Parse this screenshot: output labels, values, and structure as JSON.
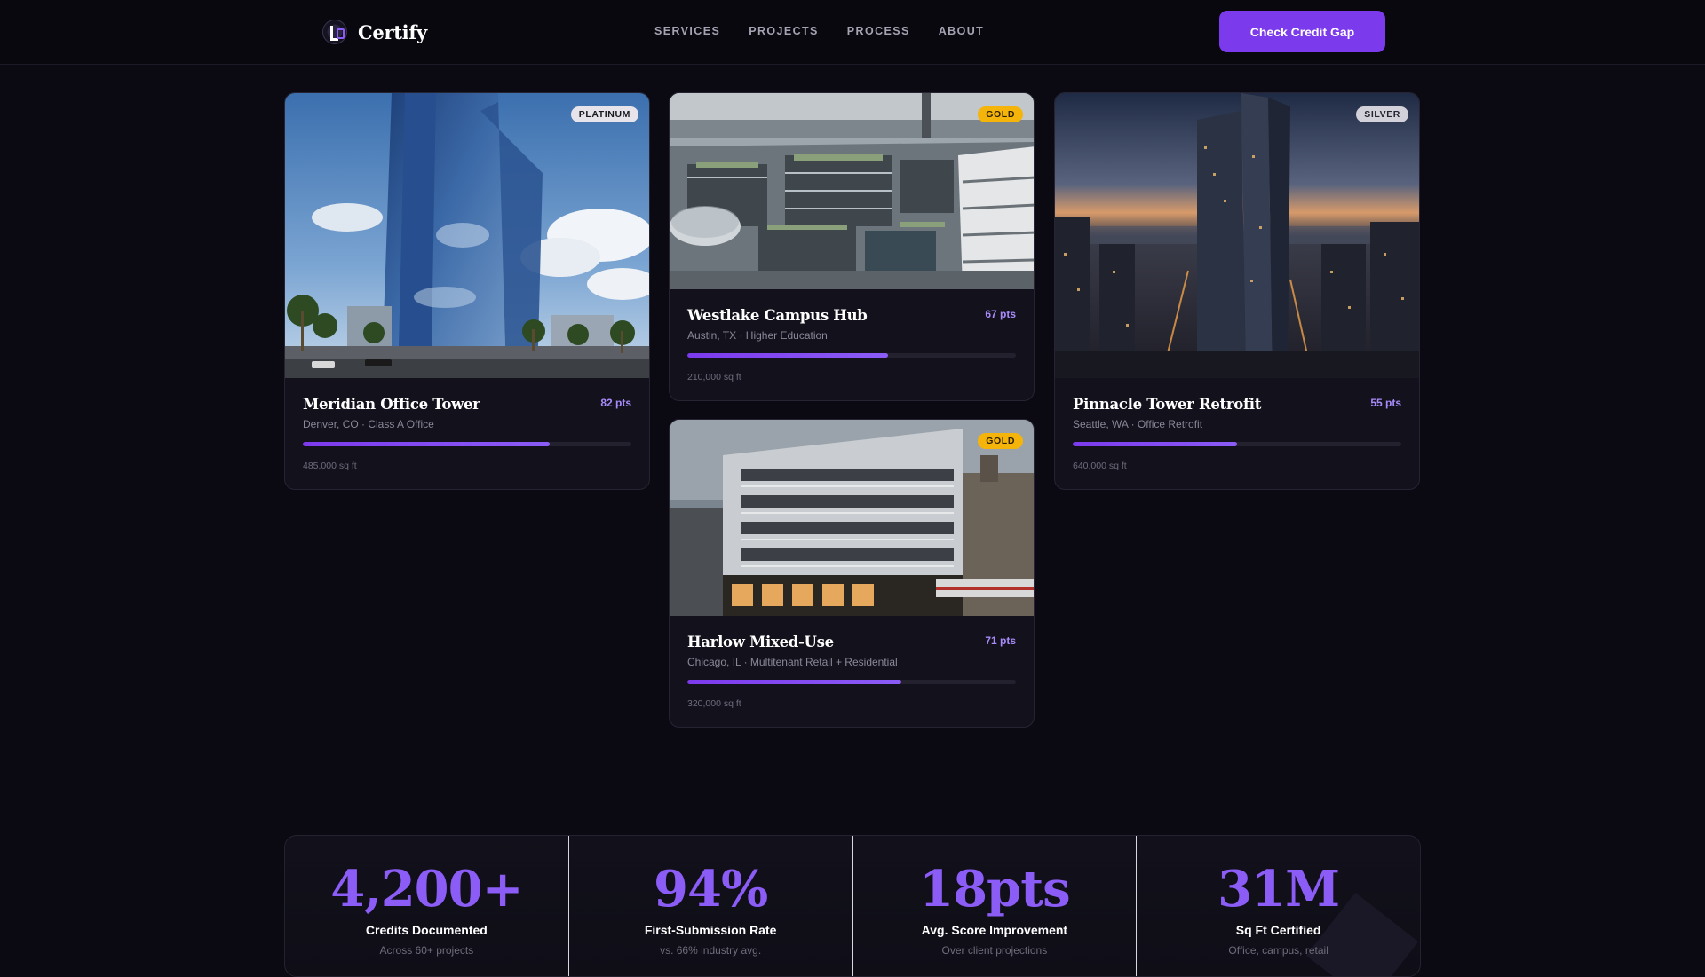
{
  "brand": {
    "name": "Certify"
  },
  "nav": {
    "links": [
      "SERVICES",
      "PROJECTS",
      "PROCESS",
      "ABOUT"
    ],
    "cta_label": "Check Credit Gap"
  },
  "colors": {
    "accent": "#7c3aed",
    "accent_light": "#8b5cf6",
    "background": "#0b0a12",
    "gold": "#f5b40a"
  },
  "projects": [
    {
      "title": "Meridian Office Tower",
      "location": "Denver, CO · Class A Office",
      "points": "82 pts",
      "badge": "PLATINUM",
      "sqft": "485,000 sq ft",
      "progress": 0.75
    },
    {
      "title": "Westlake Campus Hub",
      "location": "Austin, TX · Higher Education",
      "points": "67 pts",
      "badge": "GOLD",
      "sqft": "210,000 sq ft",
      "progress": 0.61
    },
    {
      "title": "Pinnacle Tower Retrofit",
      "location": "Seattle, WA · Office Retrofit",
      "points": "55 pts",
      "badge": "SILVER",
      "sqft": "640,000 sq ft",
      "progress": 0.5
    },
    {
      "title": "Harlow Mixed-Use",
      "location": "Chicago, IL · Multitenant Retail + Residential",
      "points": "71 pts",
      "badge": "GOLD",
      "sqft": "320,000 sq ft",
      "progress": 0.65
    }
  ],
  "stats": [
    {
      "value": "4,200+",
      "label": "Credits Documented",
      "note": "Across 60+ projects"
    },
    {
      "value": "94%",
      "label": "First-Submission Rate",
      "note": "vs. 66% industry avg."
    },
    {
      "value": "18pts",
      "label": "Avg. Score Improvement",
      "note": "Over client projections"
    },
    {
      "value": "31M",
      "label": "Sq Ft Certified",
      "note": "Office, campus, retail"
    }
  ]
}
